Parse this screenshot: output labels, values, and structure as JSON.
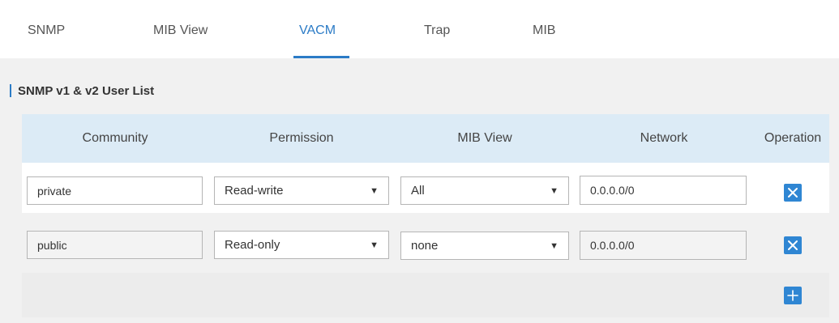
{
  "tabs": [
    {
      "label": "SNMP",
      "active": false
    },
    {
      "label": "MIB View",
      "active": false
    },
    {
      "label": "VACM",
      "active": true
    },
    {
      "label": "Trap",
      "active": false
    },
    {
      "label": "MIB",
      "active": false
    }
  ],
  "section": {
    "title": "SNMP v1 & v2 User List"
  },
  "table": {
    "headers": [
      "Community",
      "Permission",
      "MIB View",
      "Network",
      "Operation"
    ],
    "rows": [
      {
        "community": "private",
        "permission": "Read-write",
        "mib_view": "All",
        "network": "0.0.0.0/0",
        "operation_icon": "close-icon"
      },
      {
        "community": "public",
        "permission": "Read-only",
        "mib_view": "none",
        "network": "0.0.0.0/0",
        "operation_icon": "close-icon"
      }
    ],
    "add_icon": "plus-icon"
  },
  "colors": {
    "accent": "#2b7bc6",
    "button": "#2f86d3",
    "header_bg": "#dcebf6",
    "content_bg": "#f1f1f1"
  }
}
